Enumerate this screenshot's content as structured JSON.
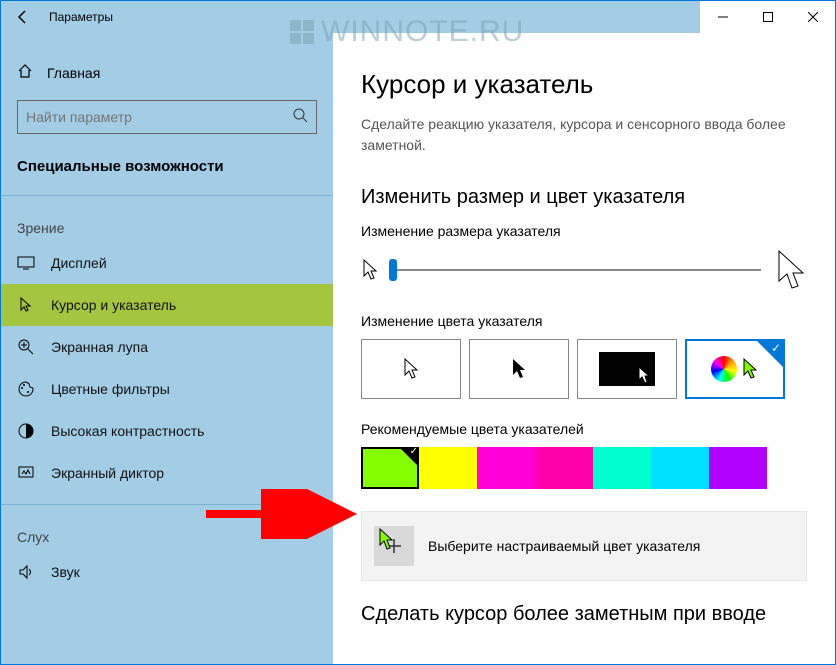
{
  "watermark": "WINNOTE.RU",
  "window": {
    "title": "Параметры"
  },
  "sidebar": {
    "home": "Главная",
    "search_placeholder": "Найти параметр",
    "section": "Специальные возможности",
    "cat_vision": "Зрение",
    "cat_hearing": "Слух",
    "items_vision": [
      {
        "label": "Дисплей"
      },
      {
        "label": "Курсор и указатель"
      },
      {
        "label": "Экранная лупа"
      },
      {
        "label": "Цветные фильтры"
      },
      {
        "label": "Высокая контрастность"
      },
      {
        "label": "Экранный диктор"
      }
    ],
    "items_hearing": [
      {
        "label": "Звук"
      }
    ]
  },
  "content": {
    "title": "Курсор и указатель",
    "desc": "Сделайте реакцию указателя, курсора и сенсорного ввода более заметной.",
    "section1": "Изменить размер и цвет указателя",
    "size_label": "Изменение размера указателя",
    "color_label": "Изменение цвета указателя",
    "recommended_label": "Рекомендуемые цвета указателей",
    "custom_label": "Выберите настраиваемый цвет указателя",
    "section2": "Сделать курсор более заметным при вводе",
    "swatches": [
      {
        "color": "#84ff00",
        "selected": true
      },
      {
        "color": "#ffff00",
        "selected": false
      },
      {
        "color": "#ff00d9",
        "selected": false
      },
      {
        "color": "#ff00aa",
        "selected": false
      },
      {
        "color": "#00ffd0",
        "selected": false
      },
      {
        "color": "#00e0ff",
        "selected": false
      },
      {
        "color": "#b400ff",
        "selected": false
      }
    ]
  }
}
